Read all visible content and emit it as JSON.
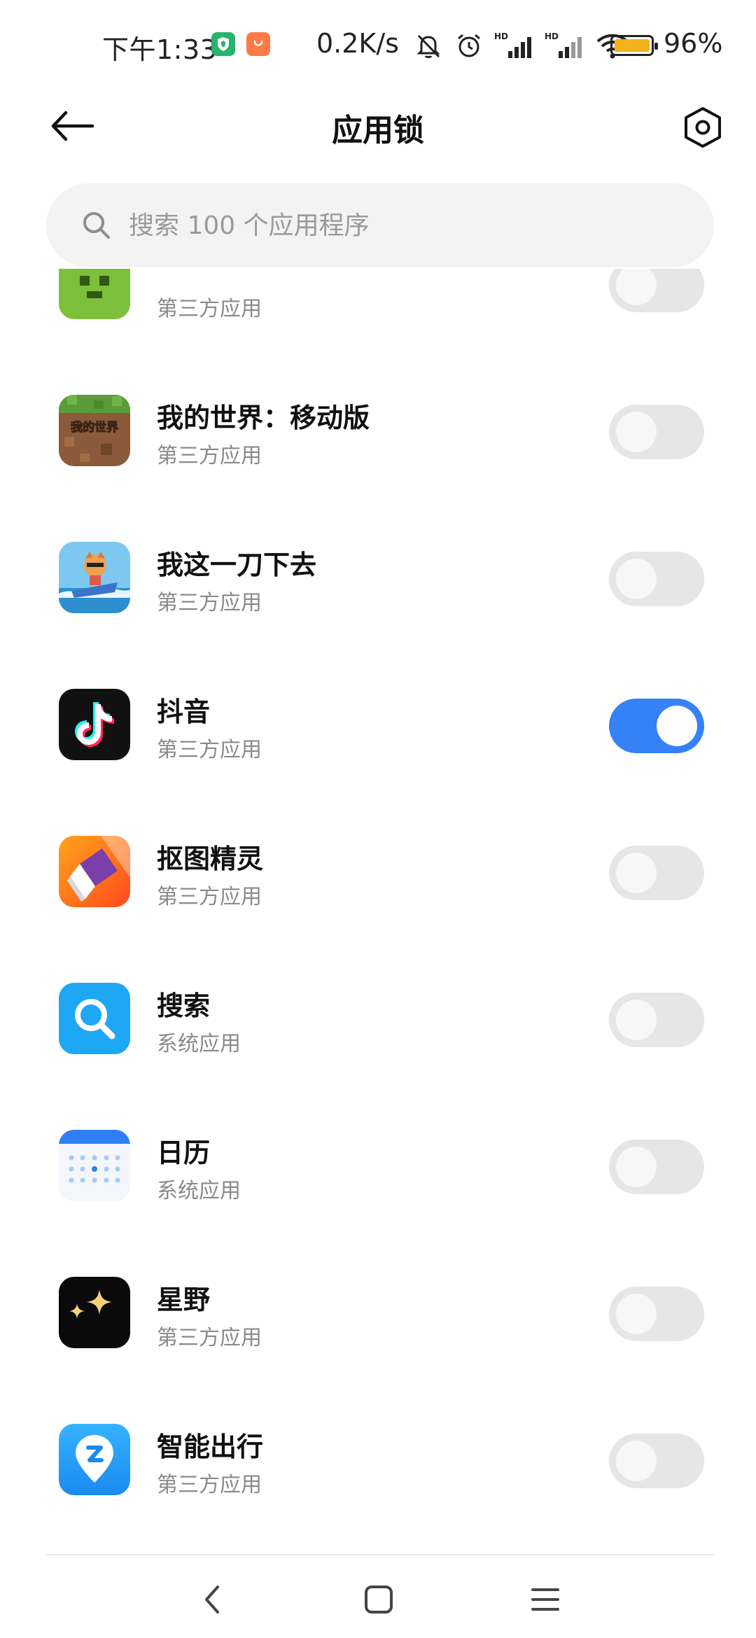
{
  "status_bar": {
    "time": "下午1:33",
    "net_speed": "0.2K/s",
    "battery_level": "96%",
    "icons": [
      "shield-badge-icon",
      "orange-app-badge-icon",
      "mute-bell-icon",
      "alarm-icon",
      "hd-signal-icon",
      "hd-signal-icon",
      "wifi-icon",
      "battery-icon"
    ]
  },
  "header": {
    "title": "应用锁",
    "back_icon": "arrow-left-icon",
    "settings_icon": "hexagon-gear-icon"
  },
  "search": {
    "placeholder": "搜索 100 个应用程序",
    "value": ""
  },
  "apps": [
    {
      "name": "",
      "type": "第三方应用",
      "locked": false,
      "icon": "green-block-icon"
    },
    {
      "name": "我的世界：移动版",
      "type": "第三方应用",
      "locked": false,
      "icon": "minecraft-icon",
      "icon_text": "我的世界"
    },
    {
      "name": "我这一刀下去",
      "type": "第三方应用",
      "locked": false,
      "icon": "game-character-icon"
    },
    {
      "name": "抖音",
      "type": "第三方应用",
      "locked": true,
      "icon": "douyin-icon"
    },
    {
      "name": "抠图精灵",
      "type": "第三方应用",
      "locked": false,
      "icon": "eraser-icon"
    },
    {
      "name": "搜索",
      "type": "系统应用",
      "locked": false,
      "icon": "search-app-icon"
    },
    {
      "name": "日历",
      "type": "系统应用",
      "locked": false,
      "icon": "calendar-icon"
    },
    {
      "name": "星野",
      "type": "第三方应用",
      "locked": false,
      "icon": "stars-icon"
    },
    {
      "name": "智能出行",
      "type": "第三方应用",
      "locked": false,
      "icon": "map-pin-icon"
    }
  ],
  "colors": {
    "toggle_on": "#3482f6",
    "toggle_off": "#e6e6e6",
    "search_bg": "#f3f3f3",
    "battery": "#f3b21b"
  },
  "nav": {
    "icons": [
      "back-chevron-icon",
      "home-square-icon",
      "menu-lines-icon"
    ]
  }
}
